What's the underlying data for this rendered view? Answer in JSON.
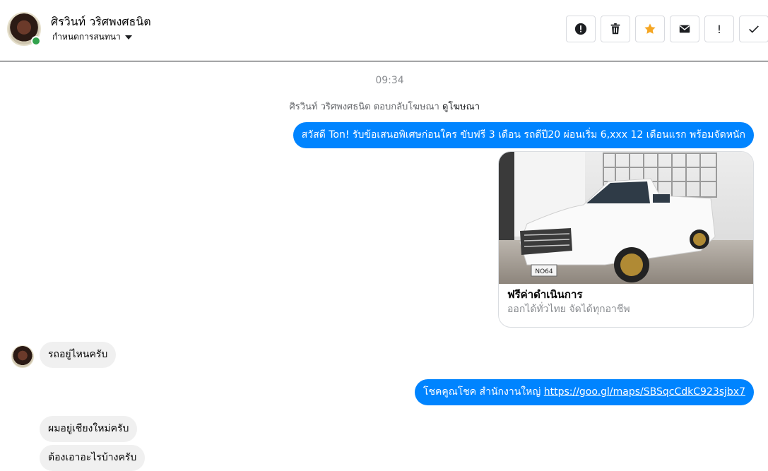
{
  "header": {
    "contact_name": "ศิรวินท์ วริศพงศธนิต",
    "conversation_label": "กำหนดการสนทนา",
    "actions": [
      "alert-circle-icon",
      "trash-icon",
      "star-icon",
      "envelope-icon",
      "exclamation-icon",
      "check-icon"
    ],
    "exclaim_label": "!",
    "star_color": "#f5a623"
  },
  "chat": {
    "timestamp": "09:34",
    "ad_reply": {
      "text": "ศิรวินท์ วริศพงศธนิต ตอบกลับโฆษณา",
      "link": "ดูโฆษณา"
    },
    "messages": [
      {
        "direction": "out",
        "text": "สวัสดี Ton! รับข้อเสนอพิเศษก่อนใคร ขับฟรี 3 เดือน รถดีปี20 ผ่อนเริ่ม 6,xxx 12 เดือนแรก  พร้อมจัดหนัก"
      },
      {
        "direction": "out",
        "type": "card",
        "title": "ฟรีค่าดำเนินการ",
        "subtitle": "ออกได้ทั่วไทย จัดได้ทุกอาชีพ",
        "plate": "NO64"
      },
      {
        "direction": "in",
        "text": "รถอยู่ไหนครับ"
      },
      {
        "direction": "out",
        "text": "โชคคูณโชค สำนักงานใหญ่ ",
        "link": "https://goo.gl/maps/SBSqcCdkC923sjbx7"
      },
      {
        "direction": "in",
        "text": "ผมอยู่เชียงใหม่ครับ"
      },
      {
        "direction": "in",
        "text": "ต้องเอาอะไรบ้างครับ"
      }
    ]
  },
  "colors": {
    "outgoing": "#0084ff",
    "incoming": "#f0f0f0",
    "online": "#31a24c"
  }
}
